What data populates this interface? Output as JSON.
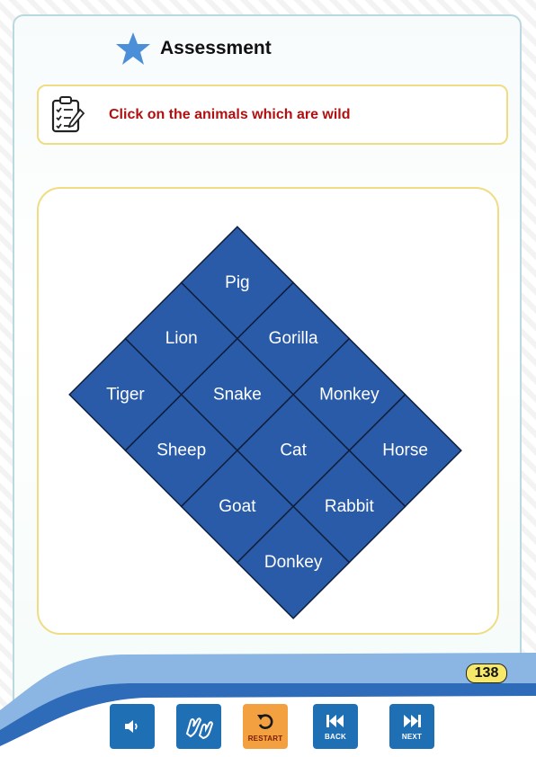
{
  "header": {
    "title": "Assessment",
    "icon": "star-icon"
  },
  "instruction": {
    "text": "Click on the animals which are wild",
    "icon": "clipboard-checklist-icon"
  },
  "puzzle": {
    "tiles": [
      {
        "label": "Pig"
      },
      {
        "label": "Lion"
      },
      {
        "label": "Gorilla"
      },
      {
        "label": "Tiger"
      },
      {
        "label": "Snake"
      },
      {
        "label": "Monkey"
      },
      {
        "label": "Sheep"
      },
      {
        "label": "Cat"
      },
      {
        "label": "Horse"
      },
      {
        "label": "Goat"
      },
      {
        "label": "Rabbit"
      },
      {
        "label": "Donkey"
      }
    ]
  },
  "page_number": "138",
  "toolbar": {
    "audio": {
      "icon": "speaker-icon"
    },
    "sign_language": {
      "icon": "sign-language-icon"
    },
    "restart": {
      "label": "RESTART",
      "icon": "restart-icon"
    },
    "back": {
      "label": "BACK",
      "icon": "back-icon"
    },
    "next": {
      "label": "NEXT",
      "icon": "next-icon"
    }
  },
  "colors": {
    "tile": "#2a5ba8",
    "instruction_text": "#b01010",
    "toolbar_button": "#1f6fb5",
    "restart_button": "#f3a040",
    "page_badge": "#f6e96a"
  }
}
